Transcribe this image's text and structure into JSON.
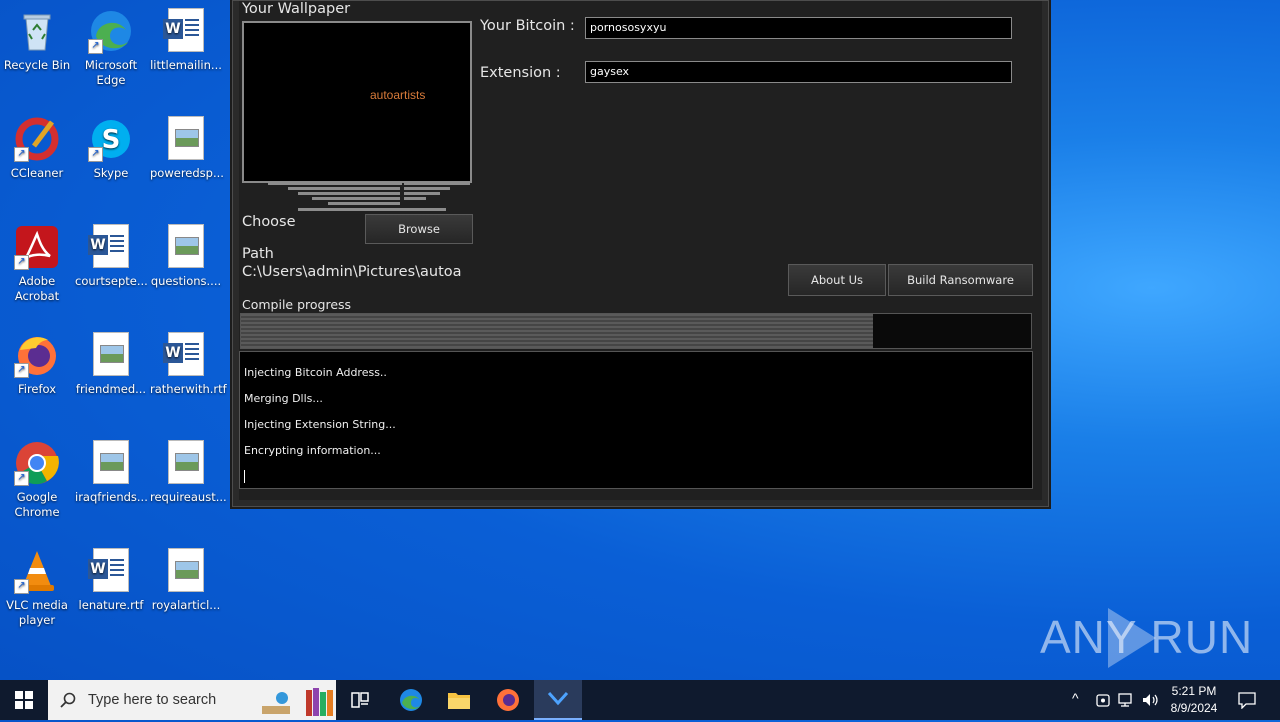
{
  "desktop": {
    "icons": [
      {
        "label": "Recycle Bin",
        "icon": "recycle-bin-icon"
      },
      {
        "label": "Microsoft Edge",
        "icon": "edge-icon"
      },
      {
        "label": "littlemailin...",
        "icon": "word-doc-icon"
      },
      {
        "label": "CCleaner",
        "icon": "ccleaner-icon"
      },
      {
        "label": "Skype",
        "icon": "skype-icon"
      },
      {
        "label": "poweredsp...",
        "icon": "image-file-icon"
      },
      {
        "label": "Adobe Acrobat",
        "icon": "acrobat-icon"
      },
      {
        "label": "courtsepte...",
        "icon": "word-doc-icon"
      },
      {
        "label": "questions....",
        "icon": "image-file-icon"
      },
      {
        "label": "Firefox",
        "icon": "firefox-icon"
      },
      {
        "label": "friendmed...",
        "icon": "image-file-icon"
      },
      {
        "label": "ratherwith.rtf",
        "icon": "word-doc-icon"
      },
      {
        "label": "Google Chrome",
        "icon": "chrome-icon"
      },
      {
        "label": "iraqfriends...",
        "icon": "image-file-icon"
      },
      {
        "label": "requireaust...",
        "icon": "image-file-icon"
      },
      {
        "label": "VLC media player",
        "icon": "vlc-icon"
      },
      {
        "label": "lenature.rtf",
        "icon": "word-doc-icon"
      },
      {
        "label": "royalarticl...",
        "icon": "image-file-icon"
      }
    ]
  },
  "app": {
    "wallpaper_label": "Your Wallpaper",
    "wallpaper_preview_text": "autoartists",
    "choose_label": "Choose",
    "browse_button": "Browse",
    "path_label": "Path",
    "path_value": "C:\\Users\\admin\\Pictures\\autoa",
    "bitcoin_label": "Your Bitcoin :",
    "bitcoin_value": "pornososyxyu",
    "extension_label": "Extension :",
    "extension_value": "gaysex",
    "about_button": "About Us",
    "build_button": "Build Ransomware",
    "compile_label": "Compile progress",
    "compile_progress": 0.8,
    "log_lines": [
      "Injecting Bitcoin Address..",
      "Merging Dlls...",
      "Injecting Extension String...",
      "Encrypting information..."
    ]
  },
  "watermark": "ANY RUN",
  "taskbar": {
    "search_placeholder": "Type here to search",
    "time": "5:21 PM",
    "date": "8/9/2024"
  }
}
